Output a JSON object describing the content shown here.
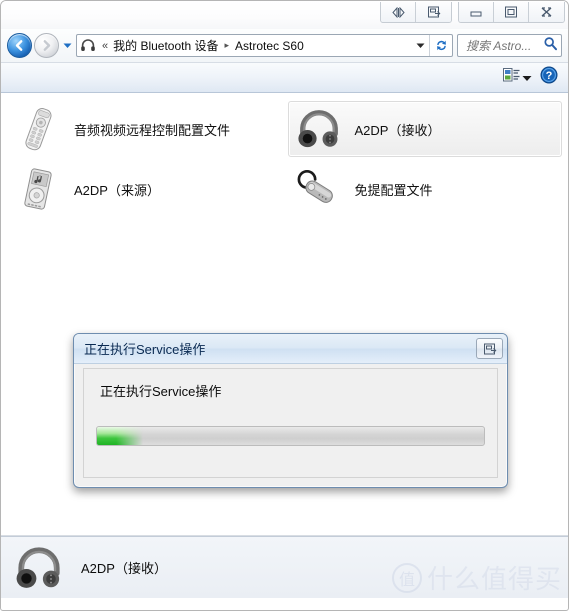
{
  "window": {
    "titlebar_buttons": [
      {
        "name": "compact-toggle-button",
        "icon": "left-right-arrows-icon"
      },
      {
        "name": "panel-toggle-button",
        "icon": "window-panel-icon"
      },
      {
        "name": "minimize-button",
        "icon": "minimize-icon"
      },
      {
        "name": "maximize-button",
        "icon": "maximize-icon"
      },
      {
        "name": "close-button",
        "icon": "close-icon"
      }
    ]
  },
  "navbar": {
    "back_title": "后退",
    "forward_title": "前进",
    "history_title": "最近浏览的页面",
    "breadcrumb_icon": "bluetooth-headset-icon",
    "overflow_chevron": "«",
    "crumbs": [
      "我的 Bluetooth 设备",
      "Astrotec S60"
    ],
    "separator": "▸",
    "dropdown_icon": "chevron-down-icon",
    "refresh_icon": "refresh-icon",
    "search_placeholder": "搜索 Astro...",
    "search_value": "",
    "search_icon": "search-icon"
  },
  "toolbar": {
    "view_options_label": "视图选项",
    "view_options_icon": "view-options-icon",
    "view_dropdown_icon": "chevron-down-icon",
    "help_label": "帮助",
    "help_icon": "help-icon"
  },
  "content": {
    "items": [
      {
        "label": "音频视频远程控制配置文件",
        "icon": "remote-control-icon",
        "selected": false
      },
      {
        "label": "A2DP（接收）",
        "icon": "headphones-icon",
        "selected": true
      },
      {
        "label": "A2DP（来源）",
        "icon": "mp3-player-icon",
        "selected": false
      },
      {
        "label": "免提配置文件",
        "icon": "bluetooth-earpiece-icon",
        "selected": false
      }
    ]
  },
  "dialog": {
    "title": "正在执行Service操作",
    "message": "正在执行Service操作",
    "titlebar_button_icon": "window-panel-icon",
    "progress_percent": 12,
    "progress_color": "#2eb82e"
  },
  "details": {
    "label": "A2DP（接收）",
    "icon": "headphones-icon"
  },
  "watermark": {
    "mark": "值",
    "text": "什么值得买"
  },
  "colors": {
    "accent": "#2f7fd1",
    "progress_green": "#2eb82e",
    "selection_bg": "#ededed"
  }
}
